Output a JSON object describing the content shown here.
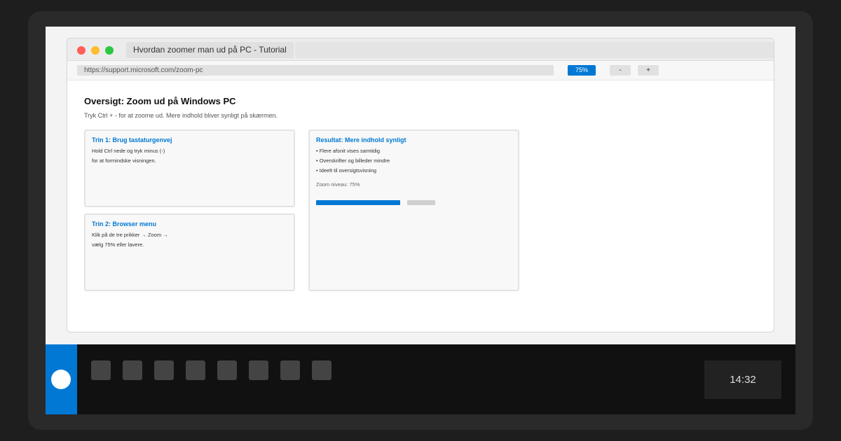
{
  "browser": {
    "tab_title": "Hvordan zoomer man ud på PC - Tutorial",
    "url": "https://support.microsoft.com/zoom-pc",
    "zoom_level": "75%",
    "zoom_out_label": "-",
    "zoom_in_label": "+"
  },
  "page": {
    "title": "Oversigt: Zoom ud på Windows PC",
    "subtitle": "Tryk Ctrl + - for at zoome ud. Mere indhold bliver synligt på skærmen.",
    "cards": [
      {
        "title": "Trin 1: Brug tastaturgenvej",
        "lines": [
          "Hold Ctrl nede og tryk minus (-)",
          "for at formindske visningen."
        ]
      },
      {
        "title": "Trin 2: Browser menu",
        "lines": [
          "Klik på de tre prikker → Zoom →",
          "vælg 75% eller lavere."
        ]
      },
      {
        "title": "Resultat: Mere indhold synligt",
        "lines": [
          "• Flere afsnit vises samtidig",
          "• Overskrifter og billeder mindre",
          "• Ideelt til oversigtsvisning"
        ],
        "zoom_label": "Zoom niveau: 75%",
        "progress_fraction": 0.75
      }
    ]
  },
  "taskbar": {
    "clock": "14:32",
    "pinned_icon_count": 8
  },
  "colors": {
    "accent": "#0078d4",
    "taskbar": "#111111"
  }
}
